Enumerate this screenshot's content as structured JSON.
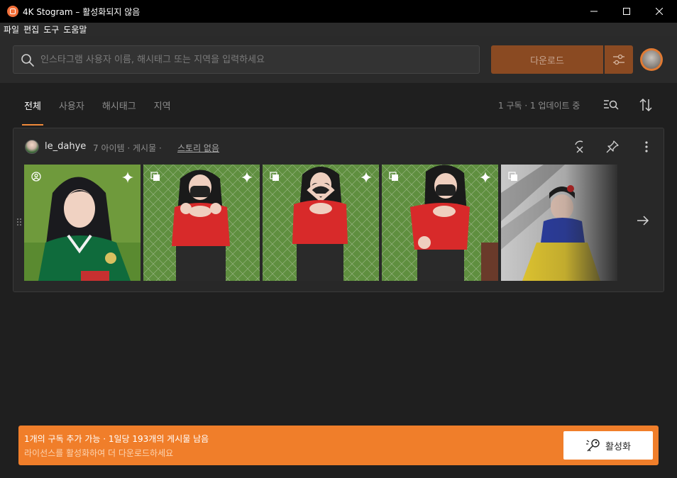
{
  "window": {
    "title": "4K Stogram – 활성화되지 않음"
  },
  "menu": {
    "items": [
      "파일",
      "편집",
      "도구",
      "도움말"
    ]
  },
  "search": {
    "placeholder": "인스타그램 사용자 이름, 해시태그 또는 지역을 입력하세요",
    "value": ""
  },
  "header": {
    "download_label": "다운로드"
  },
  "tabs": [
    {
      "label": "전체",
      "active": true
    },
    {
      "label": "사용자",
      "active": false
    },
    {
      "label": "해시태그",
      "active": false
    },
    {
      "label": "지역",
      "active": false
    }
  ],
  "status": {
    "subscriptions": "1 구독 · 1 업데이트 중"
  },
  "subscription": {
    "username": "le_dahye",
    "meta": "7 아이템 · 게시물 ·",
    "story": "스토리 없음",
    "thumbnails": [
      {
        "type": "profile-icon",
        "scene": "green-jersey"
      },
      {
        "type": "gallery-icon",
        "scene": "red-top-hands"
      },
      {
        "type": "gallery-icon",
        "scene": "red-top-heart"
      },
      {
        "type": "gallery-icon",
        "scene": "red-top-fist"
      },
      {
        "type": "gallery-icon",
        "scene": "costume"
      }
    ]
  },
  "activation": {
    "line1": "1개의 구독 추가 가능 · 1일당 193개의 게시물 남음",
    "line2": "라이선스를 활성화하여 더 다운로드하세요",
    "button_label": "활성화"
  },
  "colors": {
    "accent": "#f07e2a",
    "download_bg": "#8a4a22",
    "background": "#1f1f1f"
  }
}
